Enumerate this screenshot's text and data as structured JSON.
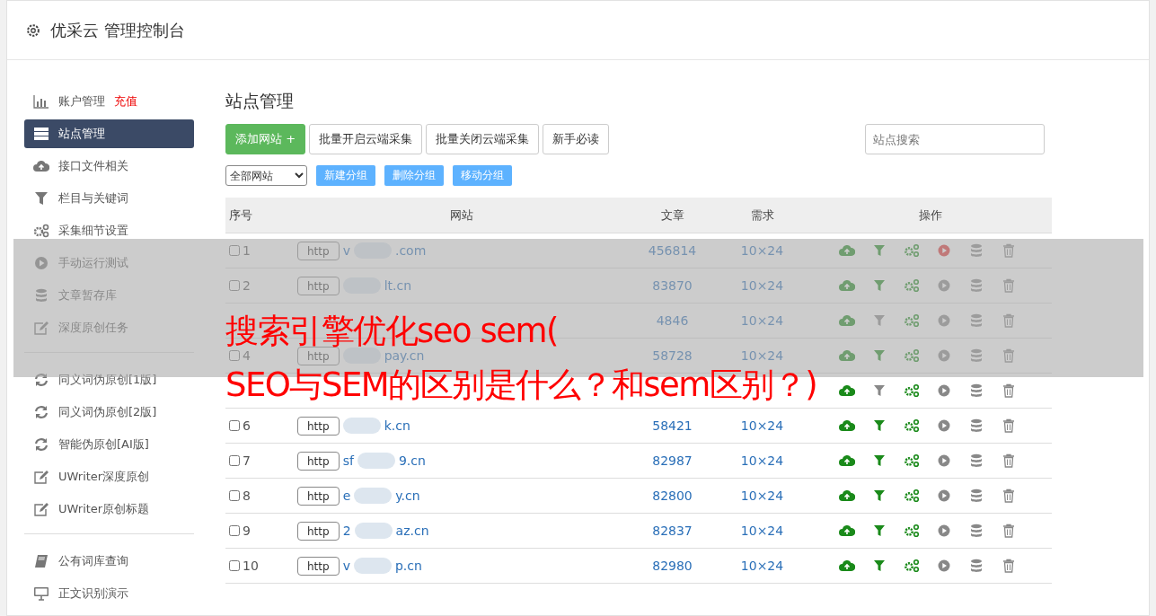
{
  "header": {
    "title": "优采云 管理控制台"
  },
  "sidebar": {
    "groups": [
      {
        "items": [
          {
            "label": "账户管理",
            "badge": "充值",
            "kind": "chart",
            "selected": false
          },
          {
            "label": "站点管理",
            "kind": "list",
            "selected": true
          },
          {
            "label": "接口文件相关",
            "kind": "cloud",
            "selected": false
          },
          {
            "label": "栏目与关键词",
            "kind": "filter",
            "selected": false
          },
          {
            "label": "采集细节设置",
            "kind": "cogs",
            "selected": false
          },
          {
            "label": "手动运行测试",
            "kind": "play",
            "selected": false
          },
          {
            "label": "文章暂存库",
            "kind": "database",
            "selected": false
          },
          {
            "label": "深度原创任务",
            "kind": "edit",
            "selected": false
          }
        ]
      },
      {
        "items": [
          {
            "label": "同义词伪原创[1版]",
            "kind": "refresh",
            "selected": false
          },
          {
            "label": "同义词伪原创[2版]",
            "kind": "refresh",
            "selected": false
          },
          {
            "label": "智能伪原创[AI版]",
            "kind": "refresh",
            "selected": false
          },
          {
            "label": "UWriter深度原创",
            "kind": "edit",
            "selected": false
          },
          {
            "label": "UWriter原创标题",
            "kind": "edit",
            "selected": false
          }
        ]
      },
      {
        "items": [
          {
            "label": "公有词库查询",
            "kind": "book",
            "selected": false
          },
          {
            "label": "正文识别演示",
            "kind": "monitor",
            "selected": false
          }
        ]
      }
    ]
  },
  "main": {
    "title": "站点管理",
    "toolbar": {
      "add_button": "添加网站",
      "add_icon": "+",
      "buttons": [
        "批量开启云端采集",
        "批量关闭云端采集",
        "新手必读"
      ],
      "search": {
        "placeholder": "站点搜索"
      }
    },
    "group_bar": {
      "select_value": "全部网站",
      "buttons": [
        "新建分组",
        "删除分组",
        "移动分组"
      ]
    },
    "table": {
      "columns": [
        "序号",
        "网站",
        "文章",
        "需求",
        "操作"
      ],
      "rows": [
        {
          "index": "1",
          "checked": false,
          "protocol": "http",
          "site_start": "v",
          "site_end": ".com",
          "articles": "456814",
          "demand": "10×24",
          "filter_on": true,
          "running": true
        },
        {
          "index": "2",
          "checked": false,
          "protocol": "http",
          "site_end": "lt.cn",
          "articles": "83870",
          "demand": "10×24",
          "filter_on": true,
          "running": false
        },
        {
          "articles": "4846",
          "demand": "10×24",
          "filter_on": false,
          "running": false
        },
        {
          "index": "4",
          "checked": false,
          "protocol": "http",
          "site_end": "pay.cn",
          "articles": "58728",
          "demand": "10×24",
          "filter_on": true,
          "running": false
        },
        {
          "filter_on": false,
          "running": false
        },
        {
          "index": "6",
          "checked": false,
          "protocol": "http",
          "site_end": "k.cn",
          "articles": "58421",
          "demand": "10×24",
          "filter_on": true,
          "running": false
        },
        {
          "index": "7",
          "checked": false,
          "protocol": "http",
          "site_start": "sf",
          "site_end": "9.cn",
          "articles": "82987",
          "demand": "10×24",
          "filter_on": true,
          "running": false
        },
        {
          "index": "8",
          "checked": false,
          "protocol": "http",
          "site_start": "e",
          "site_end": "y.cn",
          "articles": "82800",
          "demand": "10×24",
          "filter_on": true,
          "running": false
        },
        {
          "index": "9",
          "checked": false,
          "protocol": "http",
          "site_start": "2",
          "site_end": "az.cn",
          "articles": "82837",
          "demand": "10×24",
          "filter_on": true,
          "running": false
        },
        {
          "index": "10",
          "checked": false,
          "protocol": "http",
          "site_start": "v",
          "site_end": "p.cn",
          "articles": "82980",
          "demand": "10×24",
          "filter_on": true,
          "running": false
        }
      ]
    }
  },
  "overlay_caption": {
    "lines": [
      "搜索引擎优化seo sem(",
      "SEO与SEM的区别是什么？和sem区别？)"
    ]
  }
}
